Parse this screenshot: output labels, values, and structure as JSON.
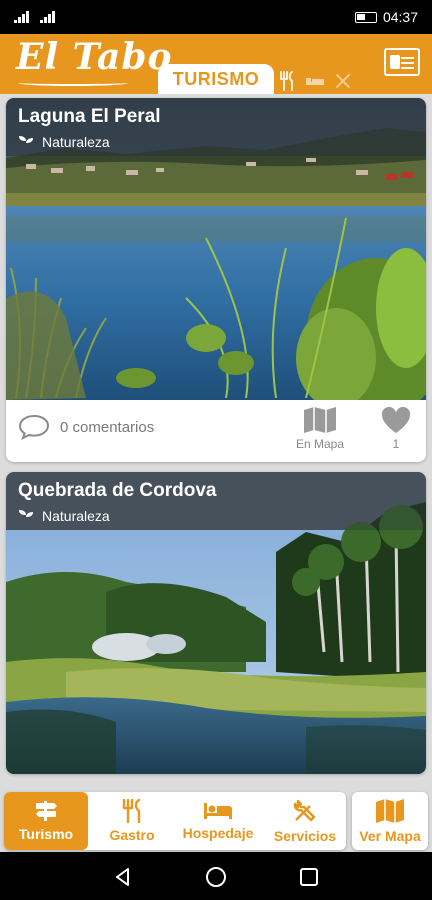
{
  "status_bar": {
    "time": "04:37",
    "icons": [
      "signal-icon",
      "signal-icon",
      "battery-icon"
    ]
  },
  "header": {
    "logo_text": "El Tabo",
    "active_tab": "TURISMO",
    "tab_icons": [
      "restaurant-icon",
      "bed-icon",
      "tools-icon"
    ],
    "profile_icon": "id-card-icon",
    "colors": {
      "brand": "#e8971e",
      "white": "#ffffff"
    }
  },
  "cards": [
    {
      "title": "Laguna El Peral",
      "category": "Naturaleza",
      "comments": "0 comentarios",
      "map_label": "En Mapa",
      "likes": "1"
    },
    {
      "title": "Quebrada de Cordova",
      "category": "Naturaleza"
    }
  ],
  "bottom_nav": {
    "items": [
      {
        "label": "Turismo",
        "icon": "signpost-icon",
        "active": true
      },
      {
        "label": "Gastro",
        "icon": "restaurant-icon",
        "active": false
      },
      {
        "label": "Hospedaje",
        "icon": "bed-icon",
        "active": false
      },
      {
        "label": "Servicios",
        "icon": "tools-icon",
        "active": false
      }
    ],
    "map_button": {
      "label": "Ver Mapa",
      "icon": "map-icon"
    }
  }
}
